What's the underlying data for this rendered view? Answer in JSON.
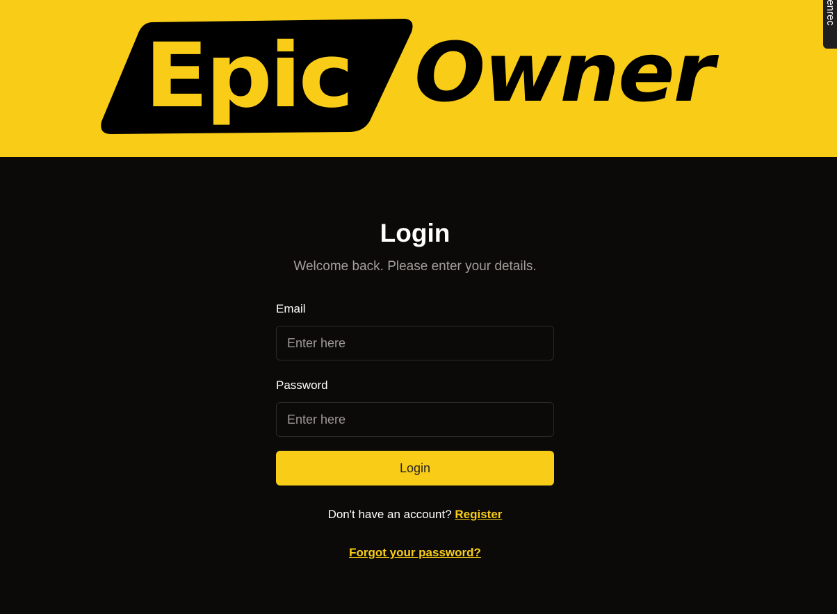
{
  "brand": {
    "logo_part1": "Epic",
    "logo_part2": "Owner",
    "accent_color": "#f9cd17",
    "background_color": "#0b0a09"
  },
  "recorder_tab": {
    "label": "reenrec"
  },
  "login": {
    "title": "Login",
    "subtitle": "Welcome back. Please enter your details.",
    "email_label": "Email",
    "email_placeholder": "Enter here",
    "email_value": "",
    "password_label": "Password",
    "password_placeholder": "Enter here",
    "password_value": "",
    "submit_label": "Login",
    "register_prompt": "Don't have an account?",
    "register_link": "Register",
    "forgot_link": "Forgot your password?"
  }
}
